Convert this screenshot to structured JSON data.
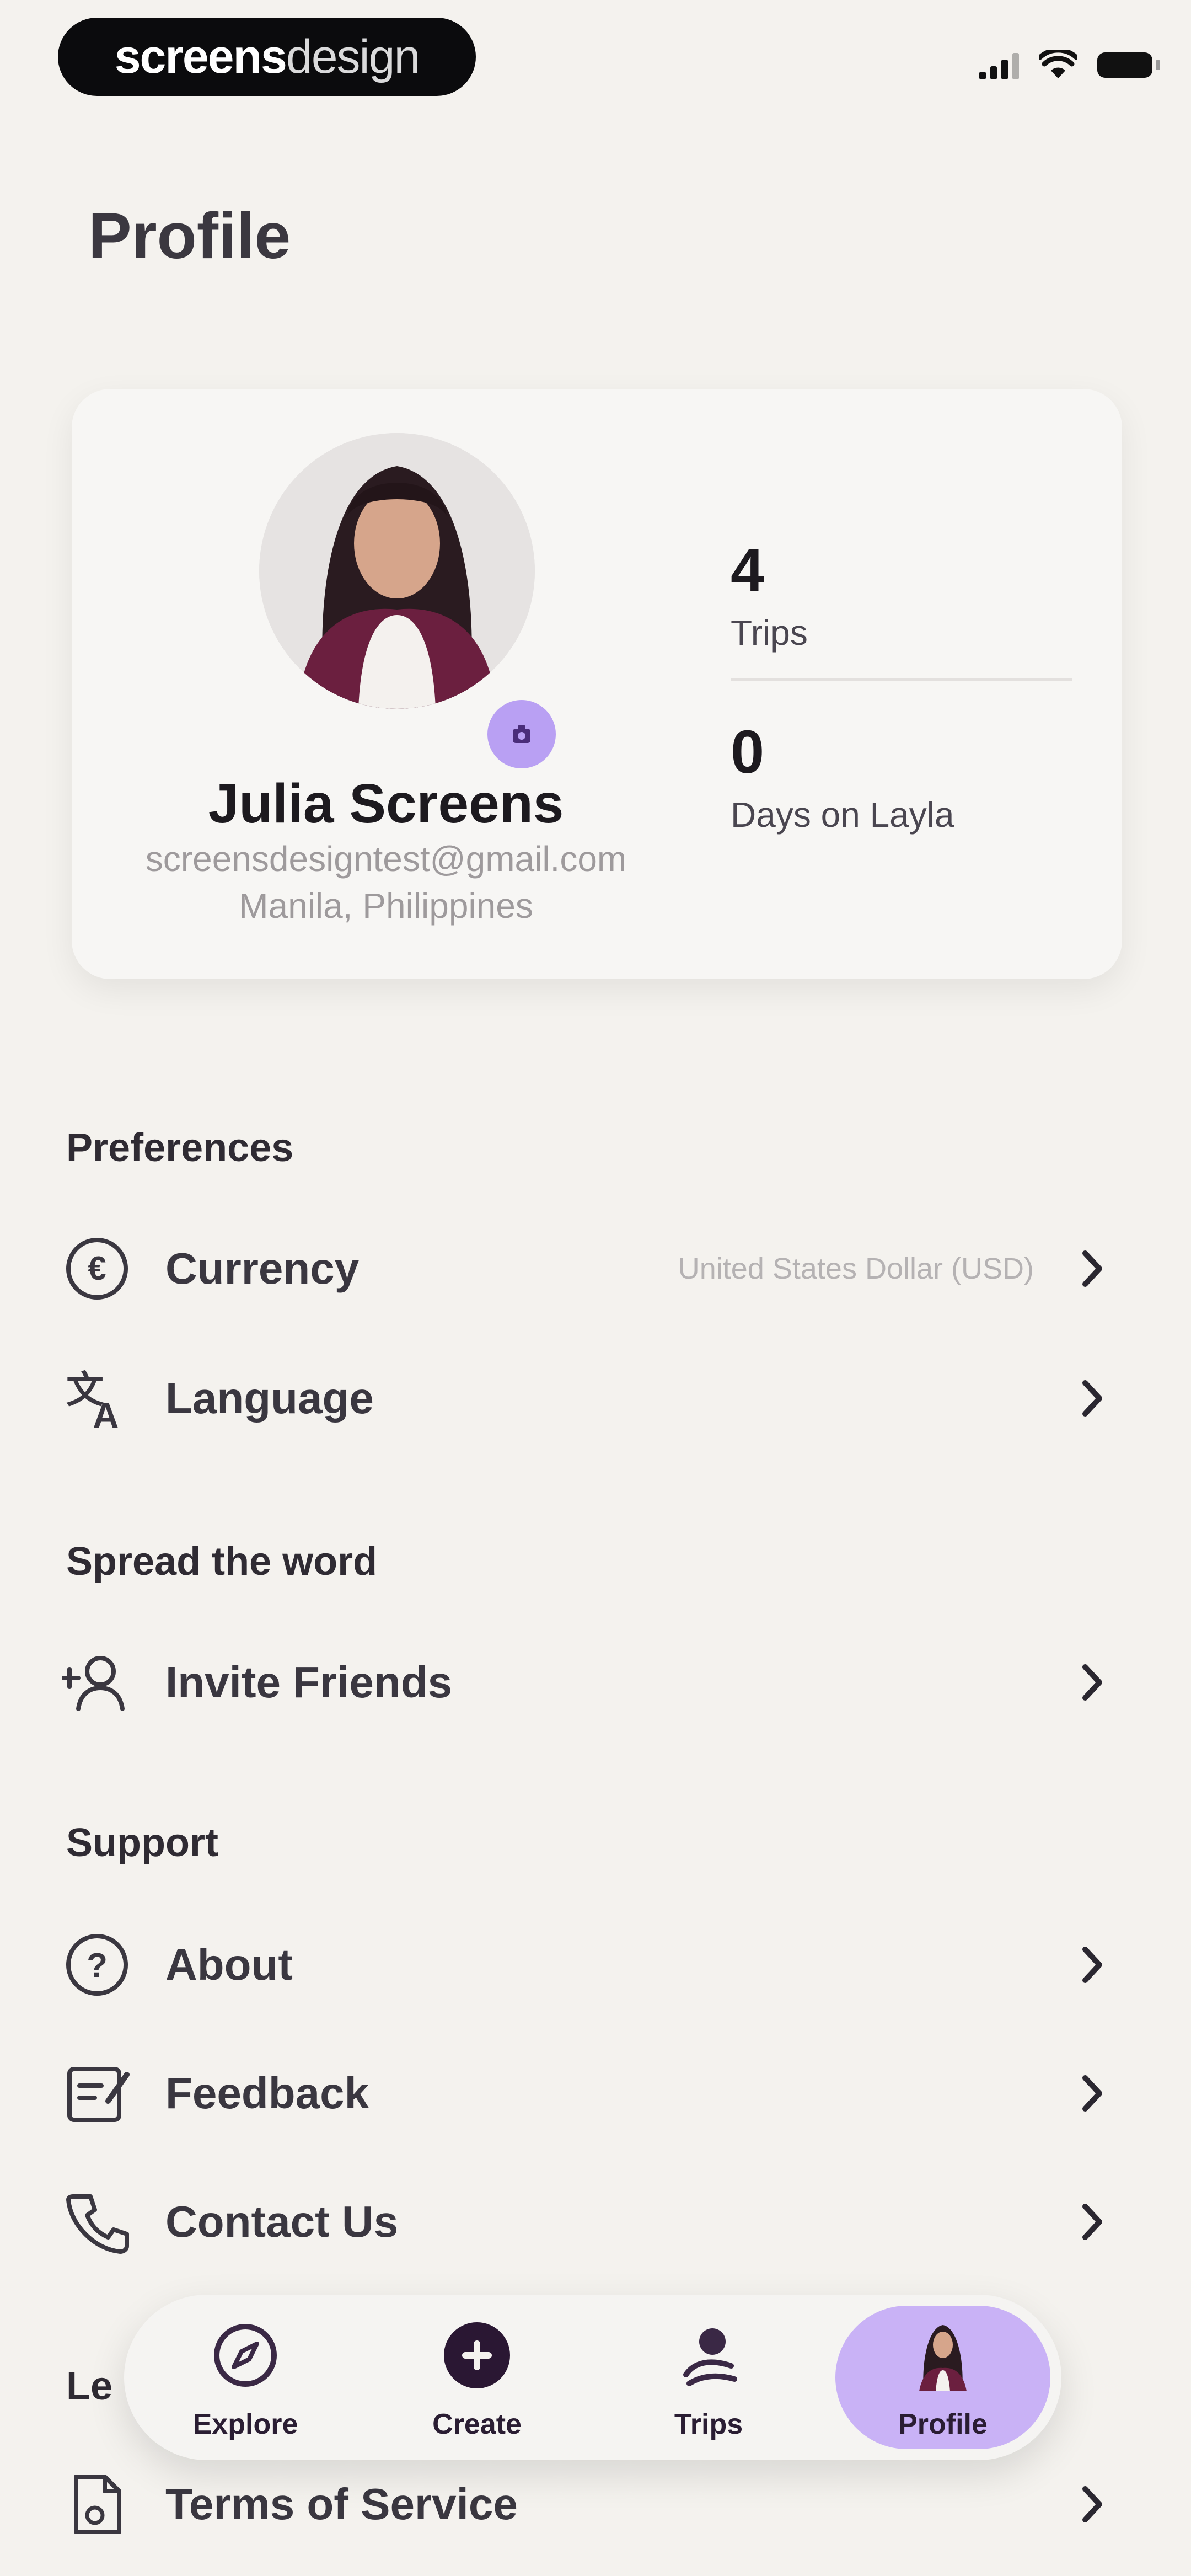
{
  "status_bar": {
    "brand_part1": "screens",
    "brand_part2": "design"
  },
  "page": {
    "title": "Profile"
  },
  "profile": {
    "name": "Julia Screens",
    "email": "screensdesigntest@gmail.com",
    "location": "Manila, Philippines",
    "avatar_icon": "person-photo",
    "stats": [
      {
        "value": "4",
        "label": "Trips"
      },
      {
        "value": "0",
        "label": "Days on Layla"
      }
    ]
  },
  "sections": {
    "preferences": "Preferences",
    "spread": "Spread the word",
    "support": "Support",
    "legal_partial": "Le"
  },
  "menu": {
    "currency": {
      "label": "Currency",
      "value": "United States Dollar (USD)",
      "icon": "euro-circle-icon"
    },
    "language": {
      "label": "Language",
      "icon": "translate-icon"
    },
    "invite": {
      "label": "Invite Friends",
      "icon": "add-user-icon"
    },
    "about": {
      "label": "About",
      "icon": "question-circle-icon"
    },
    "feedback": {
      "label": "Feedback",
      "icon": "feedback-icon"
    },
    "contact": {
      "label": "Contact Us",
      "icon": "phone-icon"
    },
    "terms": {
      "label": "Terms of Service",
      "icon": "document-icon"
    }
  },
  "tabbar": {
    "tabs": [
      {
        "label": "Explore",
        "icon": "compass-icon"
      },
      {
        "label": "Create",
        "icon": "create-icon"
      },
      {
        "label": "Trips",
        "icon": "trips-icon"
      },
      {
        "label": "Profile",
        "icon": "avatar-icon"
      }
    ],
    "active": "Profile"
  },
  "colors": {
    "background": "#f4f2ee",
    "accent": "#c9b2f6",
    "text": "#1d1a1f"
  }
}
